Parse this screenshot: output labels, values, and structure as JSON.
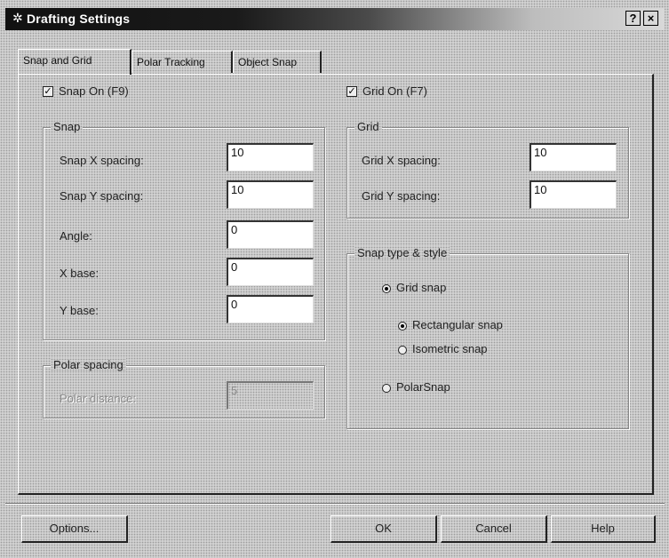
{
  "window": {
    "title": "Drafting Settings",
    "icon": "drafting-settings-icon",
    "help_button": "?",
    "close_button": "×"
  },
  "tabs": [
    {
      "label": "Snap and Grid",
      "active": true
    },
    {
      "label": "Polar Tracking",
      "active": false
    },
    {
      "label": "Object Snap",
      "active": false
    }
  ],
  "snap_on": {
    "label": "Snap On (F9)",
    "checked": true
  },
  "grid_on": {
    "label": "Grid On (F7)",
    "checked": true
  },
  "snap_group": {
    "title": "Snap",
    "x_spacing": {
      "label": "Snap X spacing:",
      "value": "10"
    },
    "y_spacing": {
      "label": "Snap Y spacing:",
      "value": "10"
    },
    "angle": {
      "label": "Angle:",
      "value": "0"
    },
    "x_base": {
      "label": "X base:",
      "value": "0"
    },
    "y_base": {
      "label": "Y base:",
      "value": "0"
    }
  },
  "polar_group": {
    "title": "Polar spacing",
    "distance": {
      "label": "Polar distance:",
      "value": "5"
    }
  },
  "grid_group": {
    "title": "Grid",
    "x_spacing": {
      "label": "Grid X spacing:",
      "value": "10"
    },
    "y_spacing": {
      "label": "Grid Y spacing:",
      "value": "10"
    }
  },
  "snap_type_group": {
    "title": "Snap type & style",
    "grid_snap": {
      "label": "Grid snap",
      "selected": true
    },
    "rectangular": {
      "label": "Rectangular snap",
      "selected": true
    },
    "isometric": {
      "label": "Isometric snap",
      "selected": false
    },
    "polar_snap": {
      "label": "PolarSnap",
      "selected": false
    }
  },
  "buttons": {
    "options": "Options...",
    "ok": "OK",
    "cancel": "Cancel",
    "help": "Help"
  }
}
